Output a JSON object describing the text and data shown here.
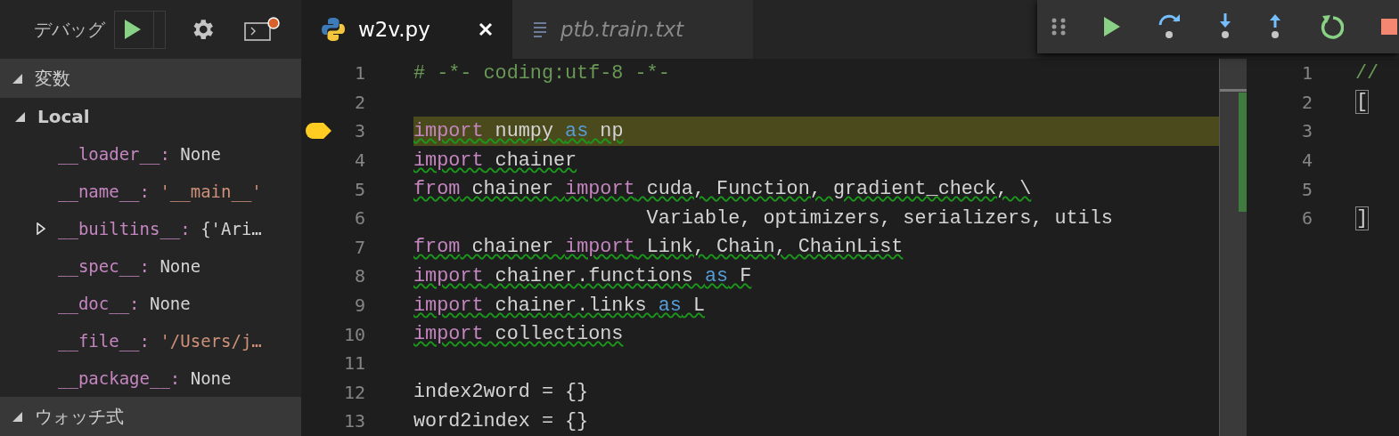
{
  "debug_panel": {
    "title": "デバッグ",
    "variables": {
      "title": "変数",
      "expanded": true,
      "scopes": [
        {
          "name": "Local",
          "expanded": true,
          "items": [
            {
              "name": "__loader__:",
              "value": "None",
              "kind": "plain"
            },
            {
              "name": "__name__:",
              "value": "'__main__'",
              "kind": "string"
            },
            {
              "name": "__builtins__:",
              "value": "{'Ari…",
              "kind": "object",
              "expanded": false
            },
            {
              "name": "__spec__:",
              "value": "None",
              "kind": "plain"
            },
            {
              "name": "__doc__:",
              "value": "None",
              "kind": "plain"
            },
            {
              "name": "__file__:",
              "value": "'/Users/j…",
              "kind": "string"
            },
            {
              "name": "__package__:",
              "value": "None",
              "kind": "plain"
            }
          ]
        }
      ]
    },
    "watch": {
      "title": "ウォッチ式",
      "expanded": true
    }
  },
  "tabs": [
    {
      "label": "w2v.py",
      "selected": true,
      "kind": "python",
      "closable": true
    },
    {
      "label": "ptb.train.txt",
      "selected": false,
      "kind": "text",
      "closable": false
    }
  ],
  "editor": {
    "lines": [
      {
        "number": "1",
        "tokens": [
          {
            "kind": "comment",
            "text": "# -*- coding:utf-8 -*-"
          }
        ],
        "warning": false,
        "current": false
      },
      {
        "number": "2",
        "current": false
      },
      {
        "number": "3",
        "tokens": [
          {
            "kind": "keyword",
            "text": "import"
          },
          {
            "kind": "plain",
            "text": " numpy "
          },
          {
            "kind": "operator",
            "text": "as"
          },
          {
            "kind": "plain",
            "text": " np"
          }
        ],
        "warning": true,
        "current": true
      },
      {
        "number": "4",
        "tokens": [
          {
            "kind": "keyword",
            "text": "import"
          },
          {
            "kind": "plain",
            "text": " chainer"
          }
        ],
        "warning": true,
        "current": false
      },
      {
        "number": "5",
        "tokens": [
          {
            "kind": "keyword",
            "text": "from"
          },
          {
            "kind": "plain",
            "text": " chainer "
          },
          {
            "kind": "keyword",
            "text": "import"
          },
          {
            "kind": "plain",
            "text": " cuda, Function, gradient_check, \\"
          }
        ],
        "warning": true,
        "current": false
      },
      {
        "number": "6",
        "tokens": [
          {
            "kind": "plain",
            "text": "                    Variable, optimizers, serializers, utils"
          }
        ],
        "warning": false,
        "current": false
      },
      {
        "number": "7",
        "tokens": [
          {
            "kind": "keyword",
            "text": "from"
          },
          {
            "kind": "plain",
            "text": " chainer "
          },
          {
            "kind": "keyword",
            "text": "import"
          },
          {
            "kind": "plain",
            "text": " Link, Chain, ChainList"
          }
        ],
        "warning": true,
        "current": false
      },
      {
        "number": "8",
        "tokens": [
          {
            "kind": "keyword",
            "text": "import"
          },
          {
            "kind": "plain",
            "text": " chainer.functions "
          },
          {
            "kind": "operator",
            "text": "as"
          },
          {
            "kind": "plain",
            "text": " F"
          }
        ],
        "warning": true,
        "current": false
      },
      {
        "number": "9",
        "tokens": [
          {
            "kind": "keyword",
            "text": "import"
          },
          {
            "kind": "plain",
            "text": " chainer.links "
          },
          {
            "kind": "operator",
            "text": "as"
          },
          {
            "kind": "plain",
            "text": " L"
          }
        ],
        "warning": true,
        "current": false
      },
      {
        "number": "10",
        "tokens": [
          {
            "kind": "keyword",
            "text": "import"
          },
          {
            "kind": "plain",
            "text": " collections"
          }
        ],
        "warning": true,
        "current": false
      },
      {
        "number": "11",
        "current": false
      },
      {
        "number": "12",
        "tokens": [
          {
            "kind": "plain",
            "text": "index2word = {}"
          }
        ],
        "warning": false,
        "current": false
      },
      {
        "number": "13",
        "tokens": [
          {
            "kind": "plain",
            "text": "word2index = {}"
          }
        ],
        "warning": false,
        "current": false
      }
    ]
  },
  "side_editor": {
    "lines": [
      {
        "number": "1",
        "tokens": [
          {
            "kind": "comment",
            "text": "//"
          }
        ]
      },
      {
        "number": "2",
        "tokens": [
          {
            "kind": "bracket",
            "text": "["
          }
        ]
      },
      {
        "number": "3"
      },
      {
        "number": "4"
      },
      {
        "number": "5"
      },
      {
        "number": "6",
        "tokens": [
          {
            "kind": "bracket",
            "text": "]"
          }
        ]
      }
    ]
  }
}
